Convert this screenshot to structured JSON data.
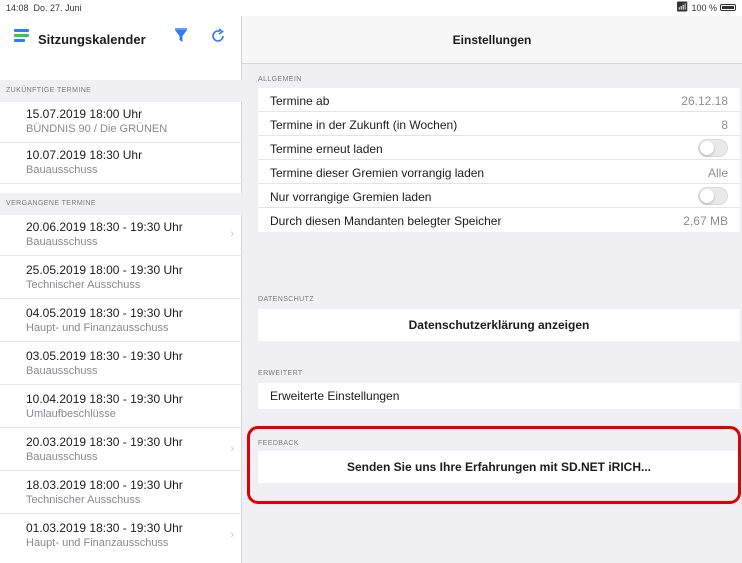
{
  "status_bar": {
    "time": "14:08",
    "date": "Do. 27. Juni",
    "battery": "100 %"
  },
  "sidebar": {
    "title": "Sitzungskalender",
    "sections": [
      {
        "header": "ZUKÜNFTIGE TERMINE",
        "items": [
          {
            "date": "15.07.2019 18:00 Uhr",
            "subtitle": "BÜNDNIS 90 / Die GRÜNEN"
          },
          {
            "date": "10.07.2019 18:30 Uhr",
            "subtitle": "Bauausschuss"
          }
        ]
      },
      {
        "header": "VERGANGENE TERMINE",
        "items": [
          {
            "date": "20.06.2019 18:30 - 19:30 Uhr",
            "subtitle": "Bauausschuss"
          },
          {
            "date": "25.05.2019 18:00 - 19:30 Uhr",
            "subtitle": "Technischer Ausschuss"
          },
          {
            "date": "04.05.2019 18:30 - 19:30 Uhr",
            "subtitle": "Haupt- und Finanzausschuss"
          },
          {
            "date": "03.05.2019 18:30 - 19:30 Uhr",
            "subtitle": "Bauausschuss"
          },
          {
            "date": "10.04.2019 18:30 - 19:30 Uhr",
            "subtitle": "Umlaufbeschlüsse"
          },
          {
            "date": "20.03.2019 18:30 - 19:30 Uhr",
            "subtitle": "Bauausschuss"
          },
          {
            "date": "18.03.2019 18:00 - 19:30 Uhr",
            "subtitle": "Technischer Ausschuss"
          },
          {
            "date": "01.03.2019 18:30 - 19:30 Uhr",
            "subtitle": "Haupt- und Finanzausschuss"
          }
        ]
      }
    ]
  },
  "main": {
    "title": "Einstellungen",
    "allgemein": {
      "header": "ALLGEMEIN",
      "rows": [
        {
          "label": "Termine ab",
          "value": "26.12.18"
        },
        {
          "label": "Termine in der Zukunft (in Wochen)",
          "value": "8"
        },
        {
          "label": "Termine erneut laden",
          "toggle": false
        },
        {
          "label": "Termine dieser Gremien vorrangig laden",
          "value": "Alle"
        },
        {
          "label": "Nur vorrangige Gremien laden",
          "toggle": false
        },
        {
          "label": "Durch diesen Mandanten belegter Speicher",
          "value": "2,67 MB"
        }
      ]
    },
    "datenschutz": {
      "header": "DATENSCHUTZ",
      "button": "Datenschutzerklärung anzeigen"
    },
    "erweitert": {
      "header": "ERWEITERT",
      "row": "Erweiterte Einstellungen"
    },
    "feedback": {
      "header": "FEEDBACK",
      "button": "Senden Sie uns Ihre Erfahrungen mit SD.NET iRICH..."
    }
  },
  "colors": {
    "accent_blue": "#2f7cf6",
    "menu_green": "#34c759",
    "highlight_red": "#e00000",
    "section_bg": "#efeff4"
  },
  "icons": {
    "menu": "menu-icon",
    "filter": "filter-icon",
    "refresh": "refresh-icon",
    "wifi": "wifi-icon",
    "battery": "battery-icon",
    "chevron": "chevron-right-icon"
  }
}
